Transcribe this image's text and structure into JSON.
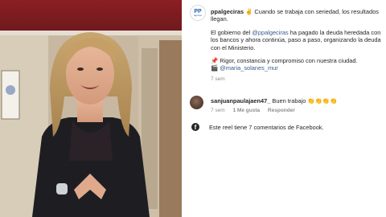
{
  "post": {
    "username": "ppalgeciras",
    "caption_line1": "Cuando se trabaja con seriedad, los resultados llegan.",
    "emoji_leaf": "✌️",
    "para2_pre": "El gobierno del ",
    "para2_mention": "@ppalgeciras",
    "para2_post": " ha pagado la deuda heredada con los bancos y ahora continúa, paso a paso, organizando la deuda con el Ministerio.",
    "pin_emoji": "📌",
    "para3_line": "Rigor, constancia y compromiso con nuestra ciudad.",
    "clap_emoji": "🎬",
    "para3_mention": "@maria_solanes_mur",
    "time": "7 sem",
    "logo_text": "PP",
    "logo_sub": "algeciras"
  },
  "comment": {
    "username": "sanjuanpaulajaen47_",
    "text": "Buen trabajo",
    "emojis": "👏👏👏👏",
    "time": "7 sem",
    "likes": "1 Me gusta",
    "reply": "Responder"
  },
  "facebook": {
    "text": "Este reel tiene 7 comentarios de Facebook.",
    "icon": "f"
  }
}
